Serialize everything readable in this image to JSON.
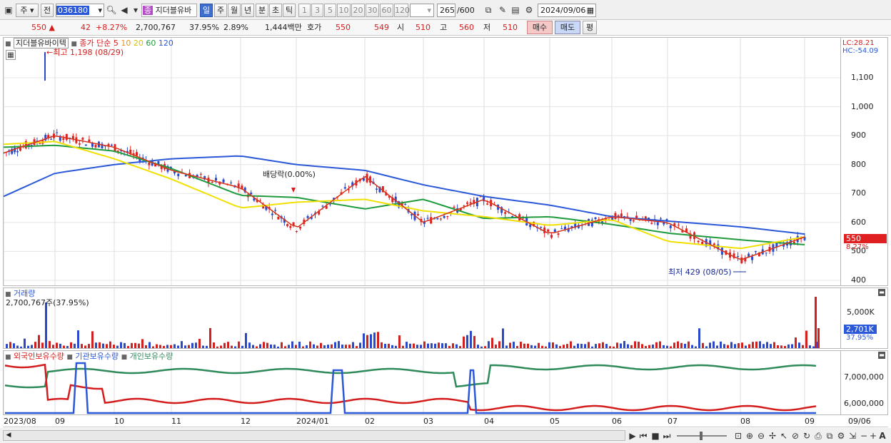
{
  "toolbar": {
    "market": "주",
    "prev_label": "전",
    "code": "036180",
    "stock_name": "지더블유바",
    "stock_badge": "종",
    "periods": [
      "일",
      "주",
      "월",
      "년",
      "분",
      "초",
      "틱"
    ],
    "active_period": "일",
    "intervals": [
      "1",
      "3",
      "5",
      "10",
      "20",
      "30",
      "60",
      "120"
    ],
    "count": "265",
    "count_max": "/600",
    "date": "2024/09/06"
  },
  "quote": {
    "price": "550",
    "change": "42",
    "change_pct": "+8.27%",
    "volume": "2,700,767",
    "turnover_pct": "37.95%",
    "ratio": "2.89%",
    "amount": "1,444백만",
    "bid_label": "호가",
    "bid1": "550",
    "bid2": "549",
    "open_label": "시",
    "open": "510",
    "high_label": "고",
    "high": "560",
    "low_label": "저",
    "low": "510",
    "buy_label": "매수",
    "sell_label": "매도",
    "avg_label": "평"
  },
  "price_panel": {
    "stock_title": "지더블유바이텍",
    "legend_prefix": "종가 단순",
    "ma_periods": [
      "5",
      "10",
      "20",
      "60",
      "120"
    ],
    "ma_colors": [
      "#d42020",
      "#e8901c",
      "#f0e000",
      "#1f9a3c",
      "#2a58d8"
    ],
    "high_note": "←최고 1,198 (08/29)",
    "low_note": "최저 429 (08/05)",
    "dividend_note": "배당락(0.00%)",
    "lc": "LC:28.21",
    "hc": "HC:-54.09",
    "y_ticks": [
      "1,100",
      "1,000",
      "900",
      "800",
      "700",
      "600",
      "500",
      "400"
    ],
    "last_price_tag": "550",
    "last_pct_tag": "8.27%"
  },
  "volume_panel": {
    "title": "거래량",
    "value": "2,700,767주(37.95%)",
    "y_tick": "5,000K",
    "last_tag": "2,701K",
    "last_pct": "37.95%"
  },
  "holdings_panel": {
    "legend": [
      "외국인보유수량",
      "기관보유수량",
      "개인보유수량"
    ],
    "legend_colors": [
      "#d41c1c",
      "#2a58d8",
      "#2f8a5a"
    ],
    "y_ticks": [
      "7,000,000",
      "6,000,000"
    ]
  },
  "x_axis": {
    "labels": [
      "2023/08",
      "09",
      "10",
      "11",
      "12",
      "2024/01",
      "02",
      "03",
      "04",
      "05",
      "06",
      "07",
      "08",
      "09"
    ],
    "right_label": "09/06"
  },
  "chart_data": {
    "type": "line",
    "title": "",
    "xlabel": "",
    "ylabel": "",
    "x": [
      "2023/08",
      "09",
      "10",
      "11",
      "12",
      "2024/01",
      "02",
      "03",
      "04",
      "05",
      "06",
      "07",
      "08",
      "09"
    ],
    "ylim": [
      400,
      1150
    ],
    "series": [
      {
        "name": "종가",
        "values": [
          840,
          900,
          860,
          780,
          720,
          580,
          760,
          600,
          680,
          560,
          620,
          600,
          470,
          550
        ]
      },
      {
        "name": "120",
        "values": [
          690,
          770,
          800,
          820,
          830,
          800,
          780,
          730,
          690,
          660,
          620,
          605,
          585,
          560
        ]
      }
    ]
  }
}
